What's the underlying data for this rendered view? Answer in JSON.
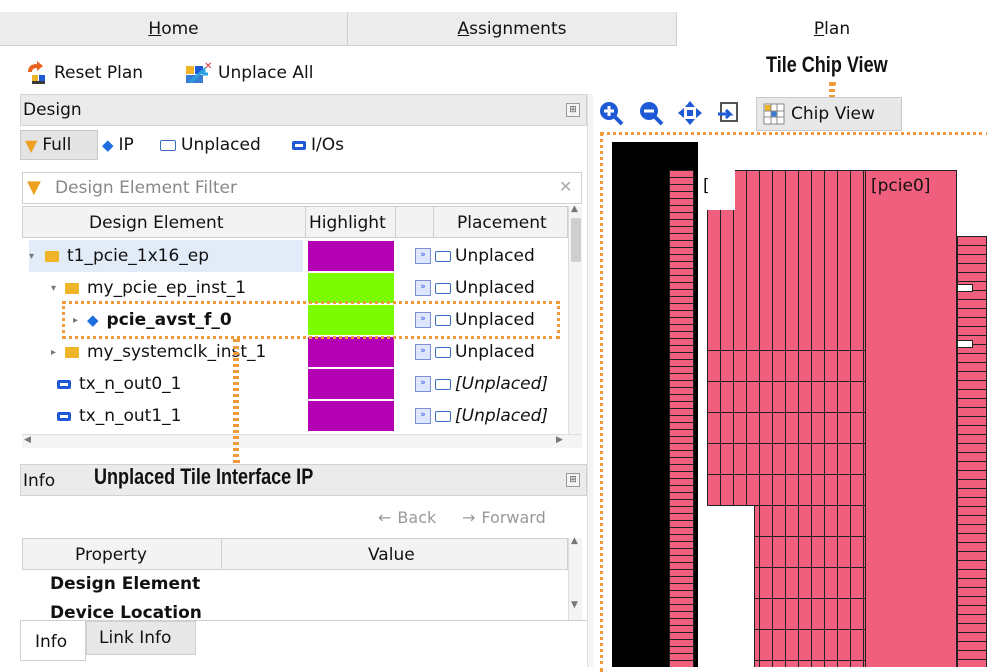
{
  "tabs": [
    {
      "label": "Home",
      "underline_char": "H"
    },
    {
      "label": "Assignments",
      "underline_char": "A"
    },
    {
      "label": "Plan",
      "underline_char": "P"
    }
  ],
  "toolbar": {
    "reset_label": "Reset Plan",
    "unplace_label": "Unplace All"
  },
  "design_panel": {
    "title": "Design",
    "filters": {
      "full": "Full",
      "ip": "IP",
      "unplaced": "Unplaced",
      "ios": "I/Os"
    },
    "search_placeholder": "Design Element Filter",
    "columns": [
      "Design Element",
      "Highlight",
      "Placement"
    ],
    "rows": [
      {
        "name": "t1_pcie_1x16_ep",
        "icon": "folder-icon",
        "color": "#b400b4",
        "placement": "Unplaced",
        "italic": false,
        "bold": false
      },
      {
        "name": "my_pcie_ep_inst_1",
        "icon": "folder-icon",
        "color": "#7cfc00",
        "placement": "Unplaced",
        "italic": false,
        "bold": false
      },
      {
        "name": "pcie_avst_f_0",
        "icon": "ip-cube-icon",
        "color": "#7cfc00",
        "placement": "Unplaced",
        "italic": false,
        "bold": true
      },
      {
        "name": "my_systemclk_inst_1",
        "icon": "folder-icon",
        "color": "#b400b4",
        "placement": "Unplaced",
        "italic": false,
        "bold": false
      },
      {
        "name": "tx_n_out0_1",
        "icon": "io-icon",
        "color": "#b400b4",
        "placement": "[Unplaced]",
        "italic": true,
        "bold": false
      },
      {
        "name": "tx_n_out1_1",
        "icon": "io-icon",
        "color": "#b400b4",
        "placement": "[Unplaced]",
        "italic": true,
        "bold": false
      }
    ]
  },
  "info_panel": {
    "title": "Info",
    "back": "Back",
    "forward": "Forward",
    "columns": [
      "Property",
      "Value"
    ],
    "rows": [
      "Design Element",
      "Device Location"
    ],
    "bottom_tabs": [
      "Info",
      "Link Info"
    ]
  },
  "chip_view": {
    "button_label": "Chip View",
    "region_label": "[pcie0]",
    "left_label": "["
  },
  "callouts": {
    "chip": "Tile Chip View",
    "ip": "Unplaced Tile Interface IP"
  },
  "colors": {
    "tile": "#f0607e",
    "highlight_magenta": "#b400b4",
    "highlight_green": "#7cfc00",
    "callout_orange": "#f09a3a"
  }
}
